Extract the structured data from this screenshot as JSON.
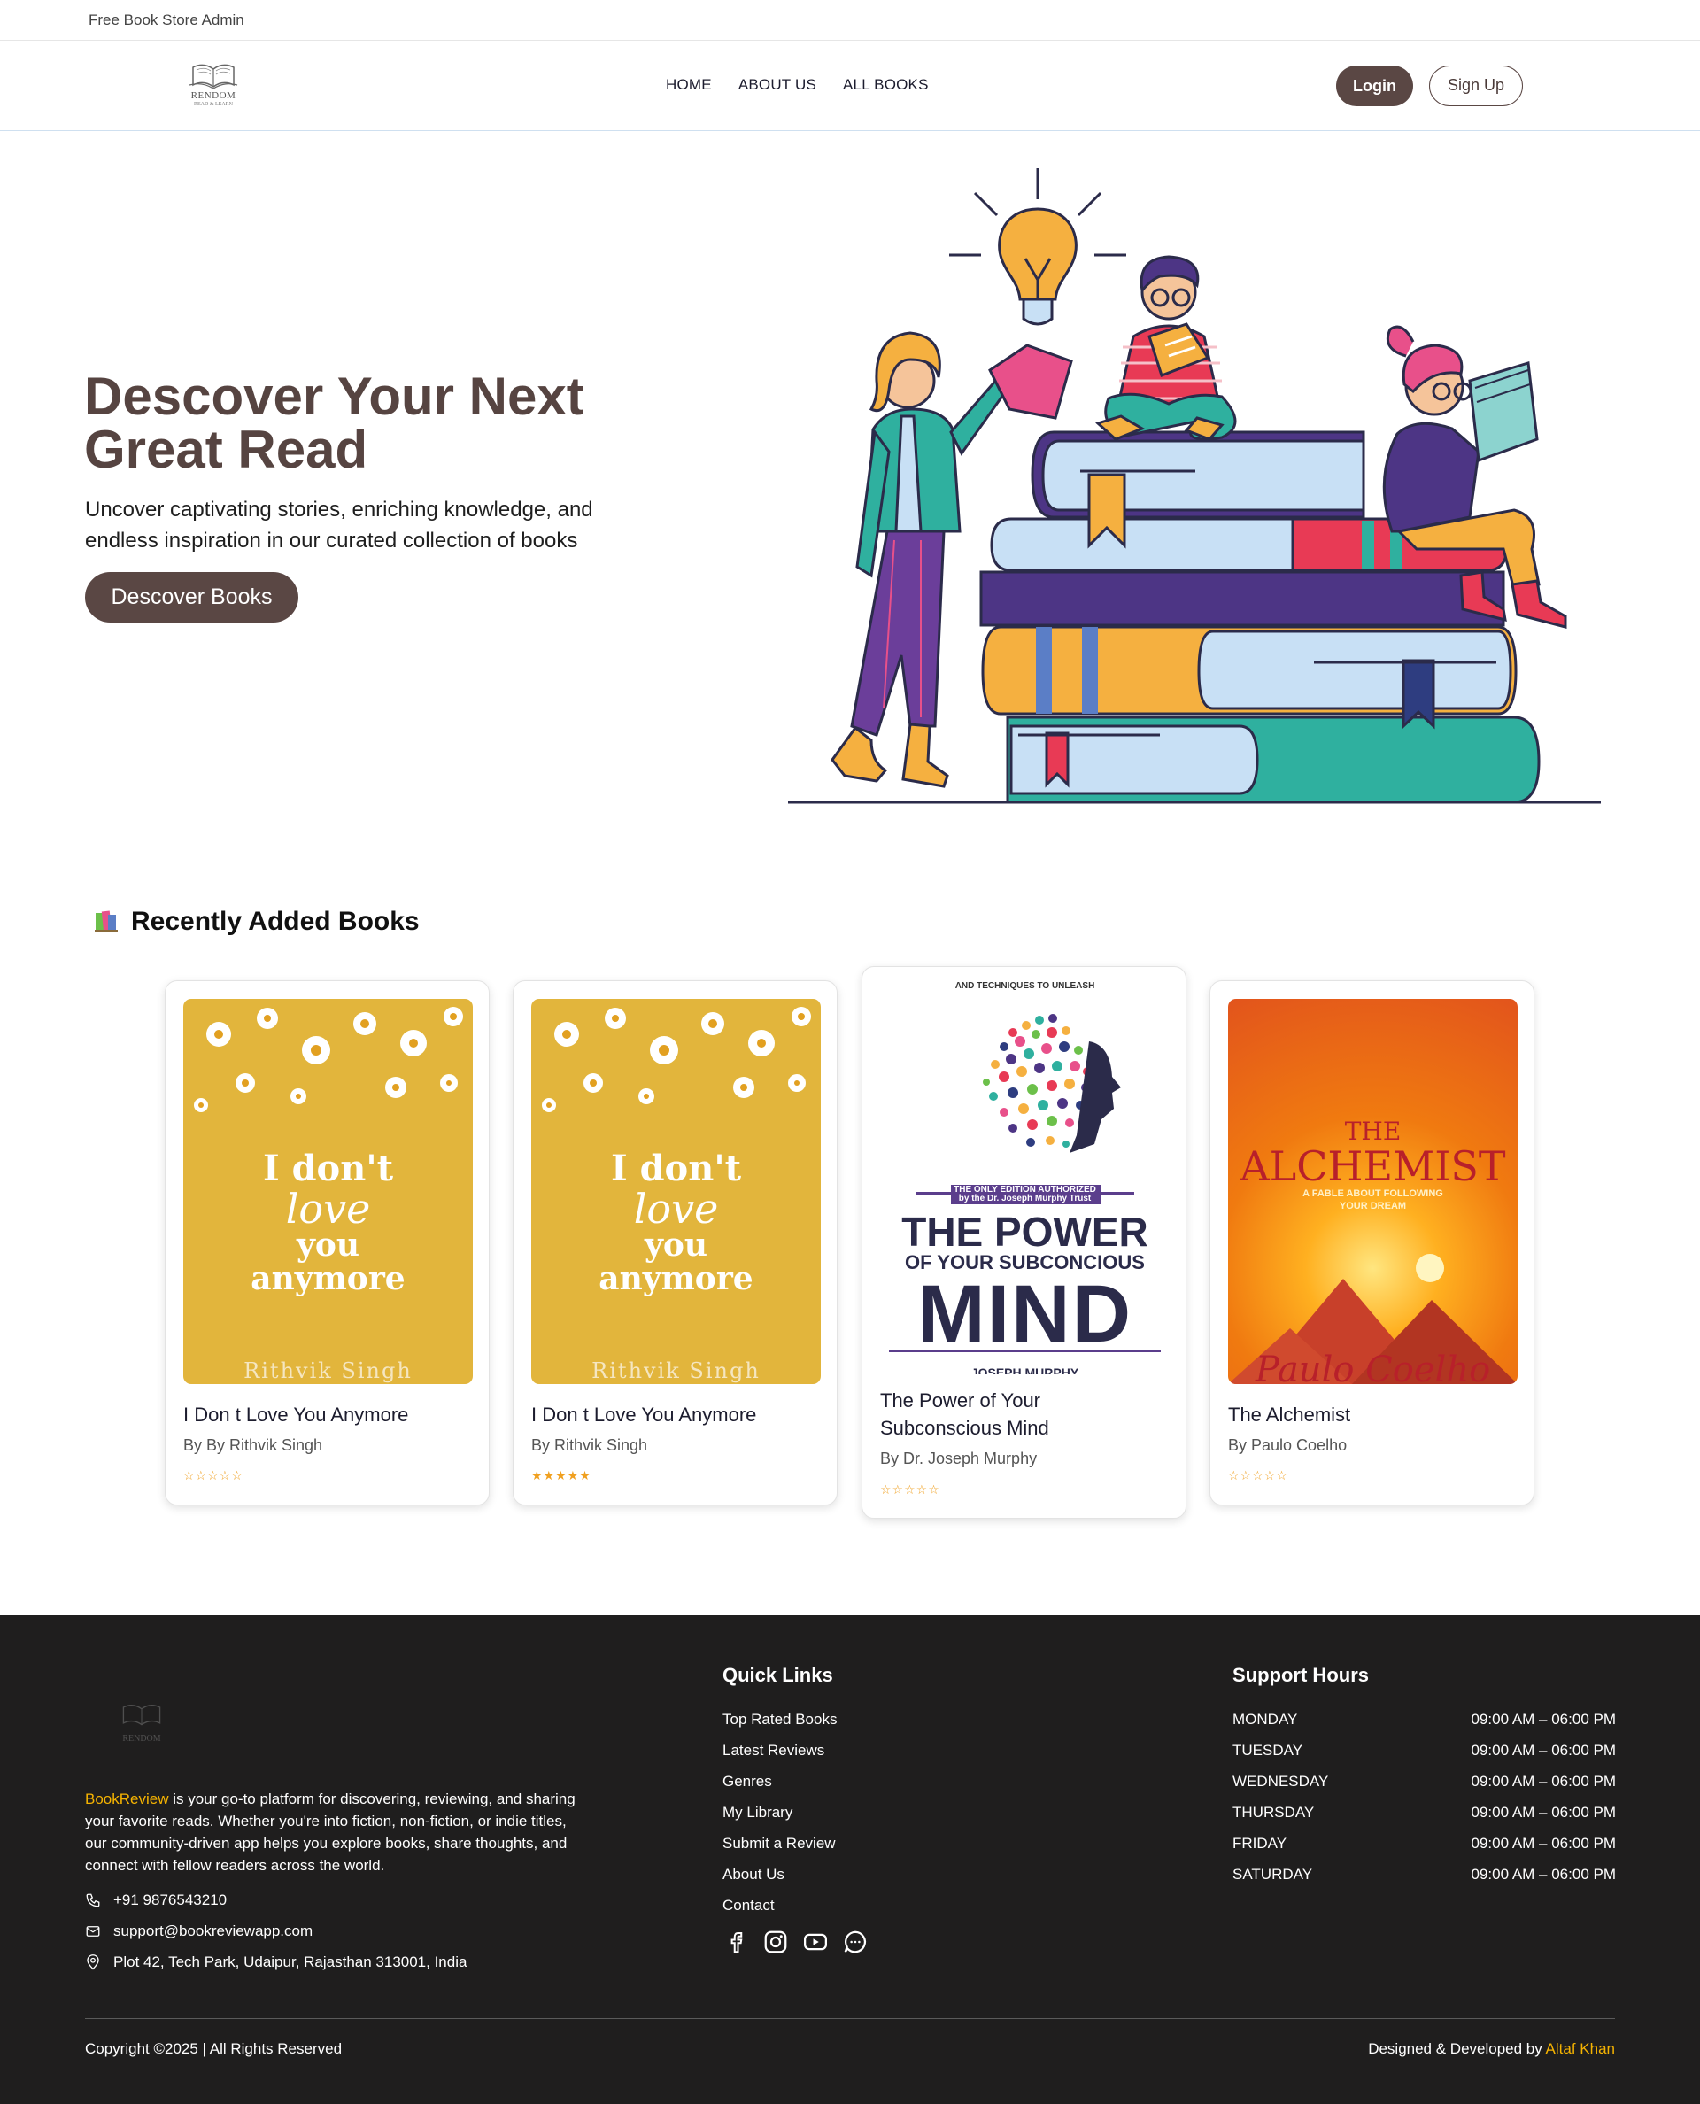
{
  "topbar": {
    "text": "Free Book Store Admin"
  },
  "header": {
    "logo_text": "RENDOM",
    "logo_tagline": "READ & LEARN",
    "nav": [
      "HOME",
      "ABOUT US",
      "ALL BOOKS"
    ],
    "login_label": "Login",
    "signup_label": "Sign Up"
  },
  "hero": {
    "title_line1": "Descover Your Next",
    "title_line2": "Great Read",
    "subtitle_line1": "Uncover captivating stories, enriching knowledge, and",
    "subtitle_line2": "endless inspiration in our curated collection of books",
    "button_label": "Descover Books"
  },
  "recent": {
    "title": "Recently Added Books",
    "books": [
      {
        "title": "I Don t Love You Anymore",
        "author": "By By Rithvik Singh",
        "rating_stars": "☆☆☆☆☆",
        "cover": {
          "line1": "I don't",
          "line2": "love",
          "line3": "you",
          "line4": "anymore",
          "author": "Rithvik Singh"
        }
      },
      {
        "title": "I Don t Love You Anymore",
        "author": "By Rithvik Singh",
        "rating_stars": "★★★★★",
        "cover": {
          "line1": "I don't",
          "line2": "love",
          "line3": "you",
          "line4": "anymore",
          "author": "Rithvik Singh"
        }
      },
      {
        "title_line1": "The Power of Your",
        "title_line2": "Subconscious Mind",
        "author": "By Dr. Joseph Murphy",
        "rating_stars": "☆☆☆☆☆",
        "cover": {
          "top": "AND TECHNIQUES TO UNLEASH",
          "badge_line1": "THE ONLY EDITION AUTHORIZED",
          "badge_line2": "by the Dr. Joseph Murphy Trust",
          "line1": "THE POWER",
          "line2": "OF YOUR SUBCONCIOUS",
          "line3": "MIND",
          "author": "JOSEPH MURPHY"
        }
      },
      {
        "title": "The Alchemist",
        "author": "By Paulo Coelho",
        "rating_stars": "☆☆☆☆☆",
        "cover": {
          "line1": "THE",
          "line2": "ALCHEMIST",
          "tag1": "A FABLE ABOUT FOLLOWING",
          "tag2": "YOUR DREAM",
          "author": "Paulo Coelho"
        }
      }
    ]
  },
  "footer": {
    "logo_text": "RENDOM",
    "about_brand": "BookReview",
    "about_rest_line1": " is your go-to platform for discovering, reviewing, and sharing",
    "about_line2": "your favorite reads. Whether you're into fiction, non-fiction, or indie titles,",
    "about_line3": "our community-driven app helps you explore books, share thoughts, and",
    "about_line4": "connect with fellow readers across the world.",
    "phone": "+91 9876543210",
    "email": "support@bookreviewapp.com",
    "address": "Plot 42, Tech Park, Udaipur, Rajasthan 313001, India",
    "quick_links_title": "Quick Links",
    "quick_links": [
      "Top Rated Books",
      "Latest Reviews",
      "Genres",
      "My Library",
      "Submit a Review",
      "About Us",
      "Contact"
    ],
    "social_icons": [
      "facebook-icon",
      "instagram-icon",
      "youtube-icon",
      "chat-icon"
    ],
    "support_title": "Support Hours",
    "hours": [
      {
        "day": "MONDAY",
        "time": "09:00 AM – 06:00 PM"
      },
      {
        "day": "TUESDAY",
        "time": "09:00 AM – 06:00 PM"
      },
      {
        "day": "WEDNESDAY",
        "time": "09:00 AM – 06:00 PM"
      },
      {
        "day": "THURSDAY",
        "time": "09:00 AM – 06:00 PM"
      },
      {
        "day": "FRIDAY",
        "time": "09:00 AM – 06:00 PM"
      },
      {
        "day": "SATURDAY",
        "time": "09:00 AM – 06:00 PM"
      }
    ],
    "copyright": "Copyright ©2025 | All Rights Reserved",
    "credit_prefix": "Designed & Developed by ",
    "credit_author": "Altaf Khan"
  },
  "colors": {
    "brand_brown": "#5a4744",
    "footer_bg": "#1f1e1e",
    "accent_yellow": "#f5b301"
  }
}
